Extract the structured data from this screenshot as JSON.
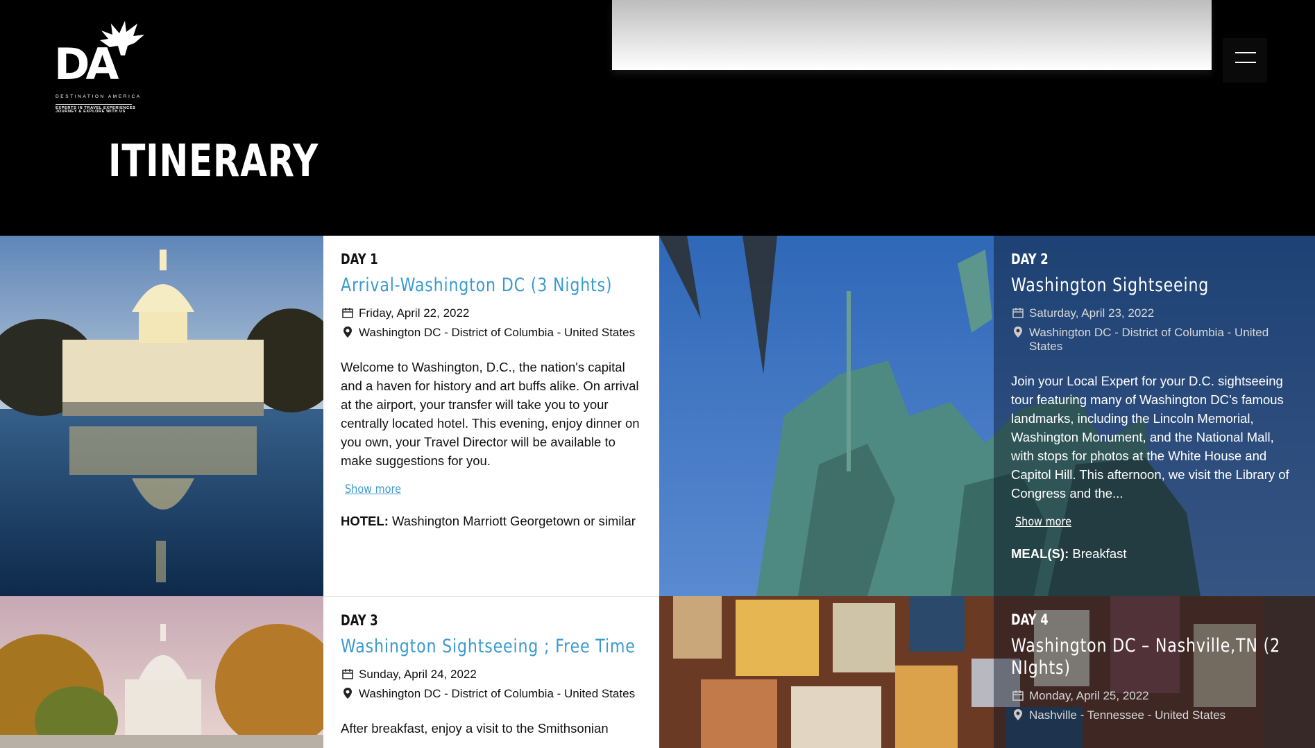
{
  "header": {
    "logo_brand": "DESTINATION AMERICA",
    "logo_tagline_1": "EXPERTS IN TRAVEL EXPERIENCES",
    "logo_tagline_2": "JOURNEY & EXPLORE WITH US",
    "logo_text": "DA",
    "menu_icon": "hamburger-icon",
    "page_title": "ITINERARY"
  },
  "days": [
    {
      "label": "DAY 1",
      "title": "Arrival-Washington DC (3 Nights)",
      "date": "Friday, April 22, 2022",
      "location": "Washington DC - District of Columbia - United States",
      "description": "Welcome to Washington, D.C., the nation's capital and a haven for history and art buffs alike. On arrival at the airport, your transfer will take you to your centrally located hotel.  This evening, enjoy dinner on you own, your Travel Director will be available to make suggestions for you.",
      "show_more": "Show more",
      "extra_label": "HOTEL:",
      "extra_value": "Washington Marriott Georgetown or similar"
    },
    {
      "label": "DAY 2",
      "title": "Washington Sightseeing",
      "date": "Saturday, April 23, 2022",
      "location": "Washington DC - District of Columbia - United States",
      "description": "Join your Local Expert for your D.C. sightseeing tour featuring many of Washington DC’s famous landmarks, including the Lincoln Memorial, Washington Monument, and the National Mall, with stops for photos at the White House and Capitol Hill. This afternoon, we visit the Library of Congress and the...",
      "show_more": "Show more",
      "extra_label": "MEAL(S):",
      "extra_value": "Breakfast"
    },
    {
      "label": "DAY 3",
      "title": "Washington Sightseeing ; Free Time",
      "date": "Sunday, April 24, 2022",
      "location": "Washington DC - District of Columbia - United States",
      "description": "After breakfast, enjoy a visit to the Smithsonian"
    },
    {
      "label": "DAY 4",
      "title": "Washington DC – Nashville,TN (2 NIghts)",
      "date": "Monday, April 25, 2022",
      "location": "Nashville - Tennessee - United States"
    }
  ],
  "icons": {
    "calendar": "calendar-icon",
    "location": "map-pin-icon"
  }
}
